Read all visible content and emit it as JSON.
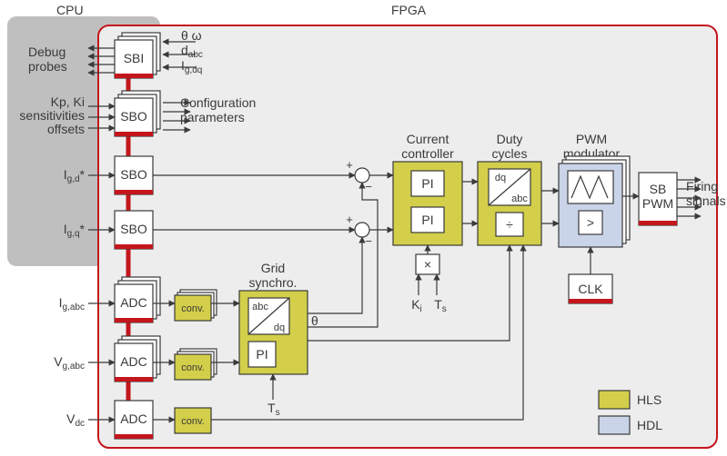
{
  "regions": {
    "cpu": "CPU",
    "fpga": "FPGA"
  },
  "sbi": {
    "name": "SBI",
    "probes_label1": "Debug",
    "probes_label2": "probes",
    "sig1": "θ  ω",
    "sig2": "d",
    "sig2_sub": "abc",
    "sig3": "I",
    "sig3_sub": "g,dq"
  },
  "sbo_cfg": {
    "name": "SBO",
    "left1": "Kp, Ki",
    "left2": "sensitivities",
    "left3": "offsets",
    "right1": "Configuration",
    "right2": "parameters"
  },
  "sbo_d": {
    "name": "SBO",
    "left": "I",
    "left_sub": "g,d",
    "left_star": "*"
  },
  "sbo_q": {
    "name": "SBO",
    "left": "I",
    "left_sub": "g,q",
    "left_star": "*"
  },
  "adc_i": {
    "name": "ADC",
    "left": "I",
    "left_sub": "g,abc"
  },
  "adc_v": {
    "name": "ADC",
    "left": "V",
    "left_sub": "g,abc"
  },
  "adc_vdc": {
    "name": "ADC",
    "left": "V",
    "left_sub": "dc"
  },
  "conv": "conv.",
  "grid_sync": {
    "title1": "Grid",
    "title2": "synchro.",
    "trans_top": "abc",
    "trans_bot": "dq",
    "pi": "PI",
    "theta": "θ",
    "ts": "T",
    "ts_sub": "s"
  },
  "cc": {
    "title1": "Current",
    "title2": "controller",
    "pi": "PI",
    "mul": "×",
    "ki": "K",
    "ki_sub": "i",
    "ts": "T",
    "ts_sub": "s"
  },
  "duty": {
    "title1": "Duty",
    "title2": "cycles",
    "trans_top": "dq",
    "trans_bot": "abc",
    "div": "÷"
  },
  "pwm": {
    "title1": "PWM",
    "title2": "modulator",
    "cmp": ">",
    "clk": "CLK"
  },
  "sbpwm": {
    "name1": "SB",
    "name2": "PWM",
    "out1": "Firing",
    "out2": "signals"
  },
  "legend": {
    "hls": "HLS",
    "hdl": "HDL"
  }
}
